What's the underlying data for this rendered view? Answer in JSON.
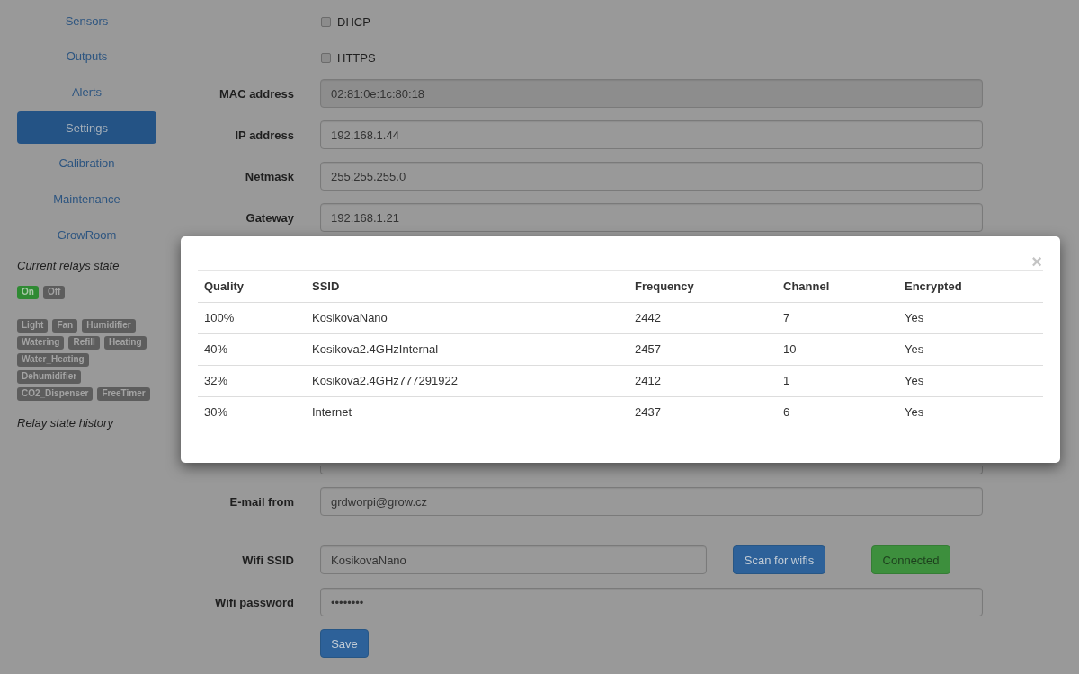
{
  "sidebar": {
    "nav": [
      {
        "label": "Sensors",
        "selected": false
      },
      {
        "label": "Outputs",
        "selected": false
      },
      {
        "label": "Alerts",
        "selected": false
      },
      {
        "label": "Settings",
        "selected": true
      },
      {
        "label": "Calibration",
        "selected": false
      },
      {
        "label": "Maintenance",
        "selected": false
      },
      {
        "label": "GrowRoom",
        "selected": false
      }
    ],
    "relays_heading": "Current relays state",
    "legend": [
      {
        "label": "On",
        "on": true
      },
      {
        "label": "Off",
        "on": false
      }
    ],
    "relays": [
      {
        "label": "Light",
        "on": false
      },
      {
        "label": "Fan",
        "on": false
      },
      {
        "label": "Humidifier",
        "on": false
      },
      {
        "label": "Watering",
        "on": false
      },
      {
        "label": "Refill",
        "on": false
      },
      {
        "label": "Heating",
        "on": false
      },
      {
        "label": "Water_Heating",
        "on": false
      },
      {
        "label": "Dehumidifier",
        "on": false
      },
      {
        "label": "CO2_Dispenser",
        "on": false
      },
      {
        "label": "FreeTimer",
        "on": false
      }
    ],
    "history_heading": "Relay state history"
  },
  "form": {
    "checkboxes": [
      {
        "label": "DHCP",
        "checked": false
      },
      {
        "label": "HTTPS",
        "checked": false
      }
    ],
    "network_fields": [
      {
        "label": "MAC address",
        "value": "02:81:0e:1c:80:18",
        "disabled": true
      },
      {
        "label": "IP address",
        "value": "192.168.1.44",
        "disabled": false
      },
      {
        "label": "Netmask",
        "value": "255.255.255.0",
        "disabled": false
      },
      {
        "label": "Gateway",
        "value": "192.168.1.21",
        "disabled": false
      }
    ],
    "email_field": {
      "label": "E-mail from",
      "value": "grdworpi@grow.cz"
    },
    "wifi_ssid": {
      "label": "Wifi SSID",
      "value": "KosikovaNano"
    },
    "scan_button": "Scan for wifis",
    "wifi_status": {
      "label": "Connected",
      "connected": true
    },
    "wifi_password": {
      "label": "Wifi password",
      "value": "••••••••"
    },
    "save_button": "Save"
  },
  "modal": {
    "close": "×",
    "table": {
      "columns": [
        "Quality",
        "SSID",
        "Frequency",
        "Channel",
        "Encrypted"
      ],
      "rows": [
        [
          "100%",
          "KosikovaNano",
          "2442",
          "7",
          "Yes"
        ],
        [
          "40%",
          "Kosikova2.4GHzInternal",
          "2457",
          "10",
          "Yes"
        ],
        [
          "32%",
          "Kosikova2.4GHz777291922",
          "2412",
          "1",
          "Yes"
        ],
        [
          "30%",
          "Internet",
          "2437",
          "6",
          "Yes"
        ]
      ]
    }
  }
}
